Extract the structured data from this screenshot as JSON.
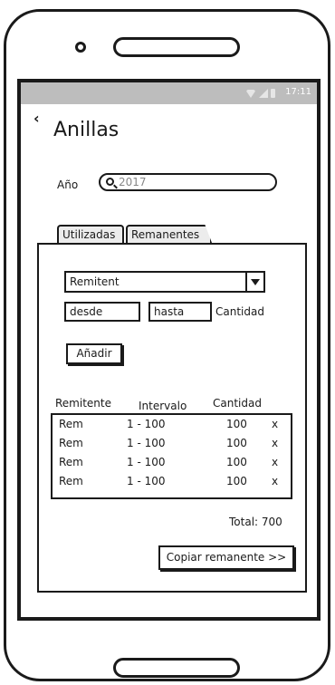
{
  "status": {
    "time": "17:11"
  },
  "header": {
    "back_icon": "chevron-left-icon",
    "title": "Anillas"
  },
  "filter": {
    "year_label": "Año",
    "year_value": "2017"
  },
  "tabs": [
    {
      "label": "Utilizadas"
    },
    {
      "label": "Remanentes"
    }
  ],
  "form": {
    "dropdown_value": "Remitent",
    "desde": "desde",
    "hasta": "hasta",
    "cantidad_label": "Cantidad",
    "add_label": "Añadir"
  },
  "table": {
    "headers": {
      "remitente": "Remitente",
      "intervalo": "Intervalo",
      "cantidad": "Cantidad"
    },
    "rows": [
      {
        "rem": "Rem",
        "intervalo": "1 - 100",
        "cantidad": "100",
        "delete": "x"
      },
      {
        "rem": "Rem",
        "intervalo": "1 - 100",
        "cantidad": "100",
        "delete": "x"
      },
      {
        "rem": "Rem",
        "intervalo": "1 - 100",
        "cantidad": "100",
        "delete": "x"
      },
      {
        "rem": "Rem",
        "intervalo": "1 - 100",
        "cantidad": "100",
        "delete": "x"
      }
    ]
  },
  "total": "Total: 700",
  "copy_button": "Copiar remanente >>"
}
